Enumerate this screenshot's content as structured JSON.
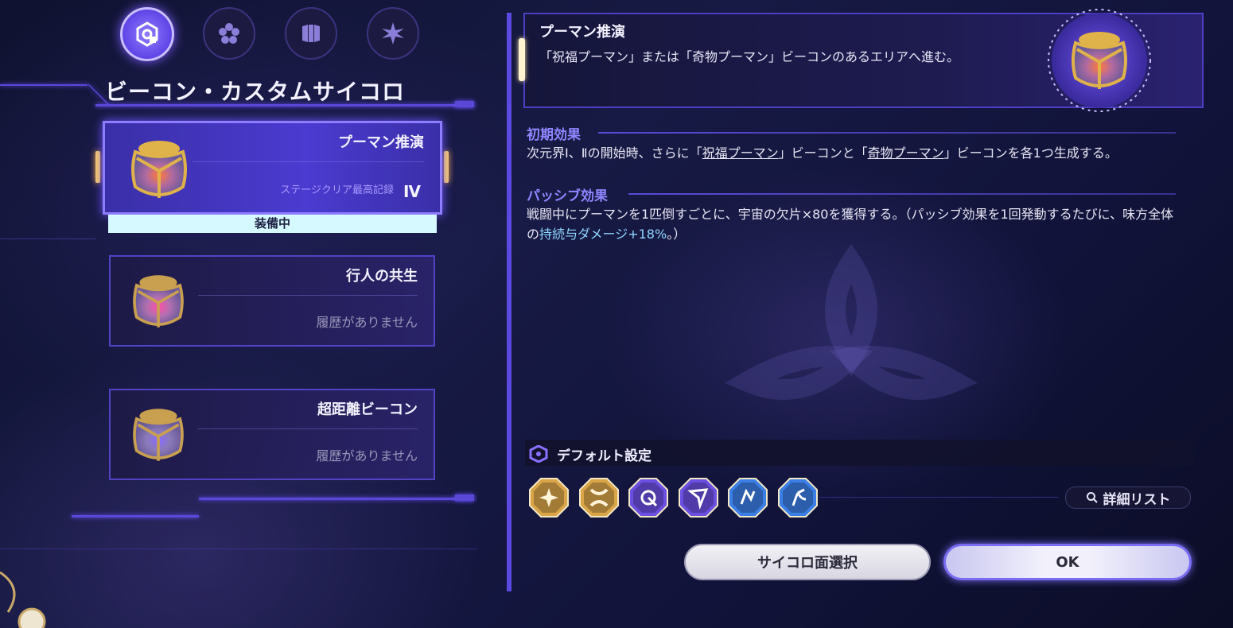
{
  "tabs": [
    {
      "icon": "hexagon-dice-icon",
      "active": true
    },
    {
      "icon": "flower-icon",
      "active": false
    },
    {
      "icon": "pillars-icon",
      "active": false
    },
    {
      "icon": "star-burst-icon",
      "active": false
    }
  ],
  "section_title": "ビーコン・カスタムサイコロ",
  "cards": [
    {
      "name": "プーマン推演",
      "record_label": "ステージクリア最高記録",
      "record_value": "Ⅳ",
      "glow": "#ff5a2e"
    },
    {
      "name": "行人の共生",
      "sub": "履歴がありません",
      "glow": "#ff4fa6"
    },
    {
      "name": "超距離ビーコン",
      "sub": "履歴がありません",
      "glow": "#8a6cff"
    }
  ],
  "equipped_label": "装備中",
  "detail": {
    "title": "プーマン推演",
    "description": "「祝福プーマン」または「奇物プーマン」ビーコンのあるエリアへ進む。",
    "initial_effect_label": "初期効果",
    "initial_effect": {
      "p1": "次元界Ⅰ、Ⅱの開始時、さらに「",
      "u1": "祝福プーマン",
      "p2": "」ビーコンと「",
      "u2": "奇物プーマン",
      "p3": "」ビーコンを各1つ生成する。"
    },
    "passive_effect_label": "パッシブ効果",
    "passive_effect": {
      "p1": "戦闘中にプーマンを1匹倒すごとに、宇宙の欠片×80を獲得する。（パッシブ効果を1回発動するたびに、味方全体の",
      "hl": "持続与ダメージ+18%",
      "p2": "。）"
    }
  },
  "default_settings": {
    "title": "デフォルト設定",
    "faces": [
      {
        "icon": "gold-shuriken-face-icon",
        "color": "#d9a548"
      },
      {
        "icon": "gold-cross-face-icon",
        "color": "#d9a548"
      },
      {
        "icon": "purple-spiral-face-icon",
        "color": "#6b4fe0"
      },
      {
        "icon": "purple-arrow-face-icon",
        "color": "#6b4fe0"
      },
      {
        "icon": "blue-rune-face-icon",
        "color": "#3b7ee6"
      },
      {
        "icon": "blue-branch-face-icon",
        "color": "#3b7ee6"
      }
    ],
    "detail_list_label": "詳細リスト"
  },
  "buttons": {
    "select_face": "サイコロ面選択",
    "ok": "OK"
  }
}
